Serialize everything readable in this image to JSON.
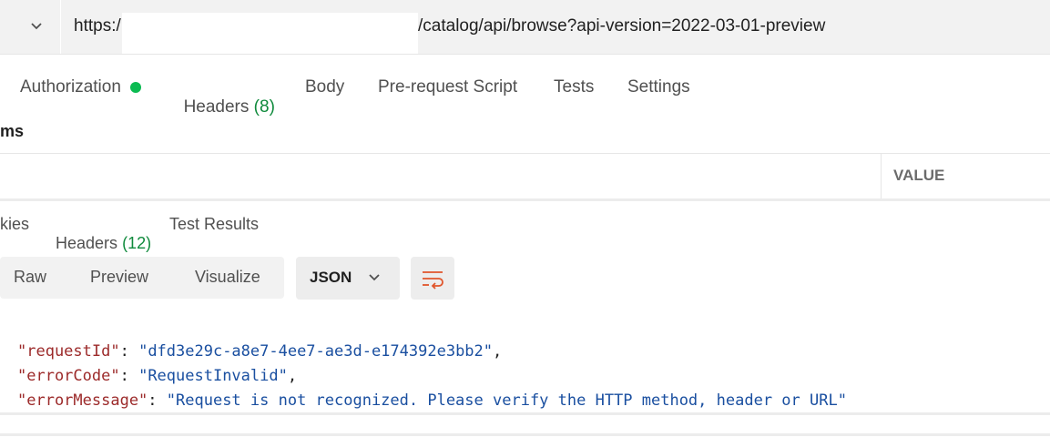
{
  "url_bar": {
    "scheme_prefix": "https:/",
    "path": "/catalog/api/browse?api-version=2022-03-01-preview"
  },
  "request_tabs": {
    "authorization": "Authorization",
    "headers": "Headers",
    "headers_count": "(8)",
    "body": "Body",
    "prerequest": "Pre-request Script",
    "tests": "Tests",
    "settings": "Settings"
  },
  "params": {
    "section_label": "ms",
    "value_header": "VALUE"
  },
  "response_tabs": {
    "cookies": "kies",
    "headers": "Headers",
    "headers_count": "(12)",
    "test_results": "Test Results"
  },
  "view": {
    "raw": "Raw",
    "preview": "Preview",
    "visualize": "Visualize",
    "format": "JSON"
  },
  "response_body": {
    "line1_key": "\"requestId\"",
    "line1_value": "\"dfd3e29c-a8e7-4ee7-ae3d-e174392e3bb2\"",
    "line2_key": "\"errorCode\"",
    "line2_value": "\"RequestInvalid\"",
    "line3_key": "\"errorMessage\"",
    "line3_value": "\"Request is not recognized. Please verify the HTTP method, header or URL\""
  },
  "colors": {
    "status_dot": "#0cbb52",
    "count_green": "#0f8a3c",
    "json_key": "#9c2a2a",
    "json_string": "#1a4fa0",
    "wrap_icon": "#e0552b"
  },
  "icons": {
    "method_dropdown": "chevron-down-icon",
    "format_dropdown": "chevron-down-icon",
    "wrap": "wrap-lines-icon"
  }
}
